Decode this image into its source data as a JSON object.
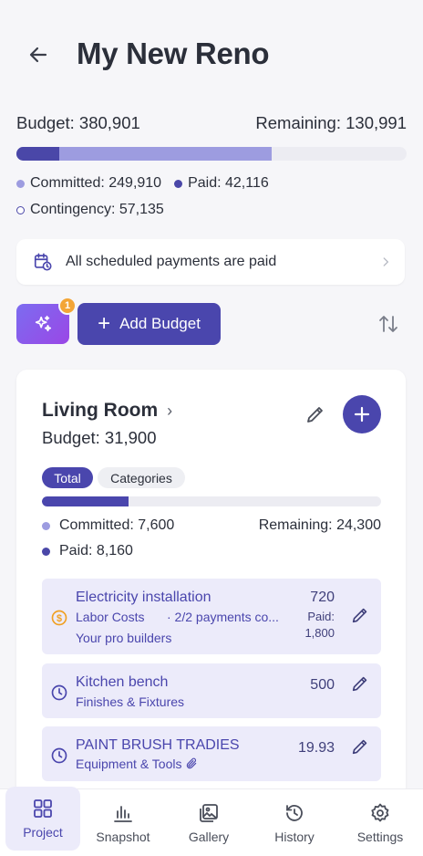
{
  "header": {
    "title": "My New Reno"
  },
  "summary": {
    "budget_label": "Budget: 380,901",
    "remaining_label": "Remaining: 130,991",
    "paid_fraction": 0.11,
    "committed_fraction": 0.655,
    "committed_label": "Committed: 249,910",
    "paid_label": "Paid: 42,116",
    "contingency_label": "Contingency: 57,135"
  },
  "notice": {
    "text": "All scheduled payments are paid"
  },
  "actions": {
    "badge_count": "1",
    "add_budget_label": "Add Budget"
  },
  "room": {
    "name": "Living Room",
    "budget_label": "Budget: 31,900",
    "tabs": [
      "Total",
      "Categories"
    ],
    "progress_fraction": 0.255,
    "committed_label": "Committed: 7,600",
    "remaining_label": "Remaining: 24,300",
    "paid_label": "Paid: 8,160",
    "items": [
      {
        "name": "Electricity installation",
        "category": "Labor Costs",
        "note": "· 2/2 payments co...",
        "supplier": "Your pro builders",
        "amount": "720",
        "paid_label": "Paid:",
        "paid_value": "1,800"
      },
      {
        "name": "Kitchen bench",
        "category": "Finishes & Fixtures",
        "amount": "500"
      },
      {
        "name": "PAINT BRUSH TRADIES",
        "category": "Equipment & Tools",
        "amount": "19.93"
      }
    ]
  },
  "nav": [
    {
      "label": "Project",
      "icon": "grid-icon"
    },
    {
      "label": "Snapshot",
      "icon": "bar-chart-icon"
    },
    {
      "label": "Gallery",
      "icon": "gallery-icon"
    },
    {
      "label": "History",
      "icon": "history-icon"
    },
    {
      "label": "Settings",
      "icon": "gear-icon"
    }
  ],
  "colors": {
    "accent": "#4a46ad",
    "committed": "#9d9ce0",
    "badge": "#f3a536",
    "item_bg": "#ecebfa"
  }
}
